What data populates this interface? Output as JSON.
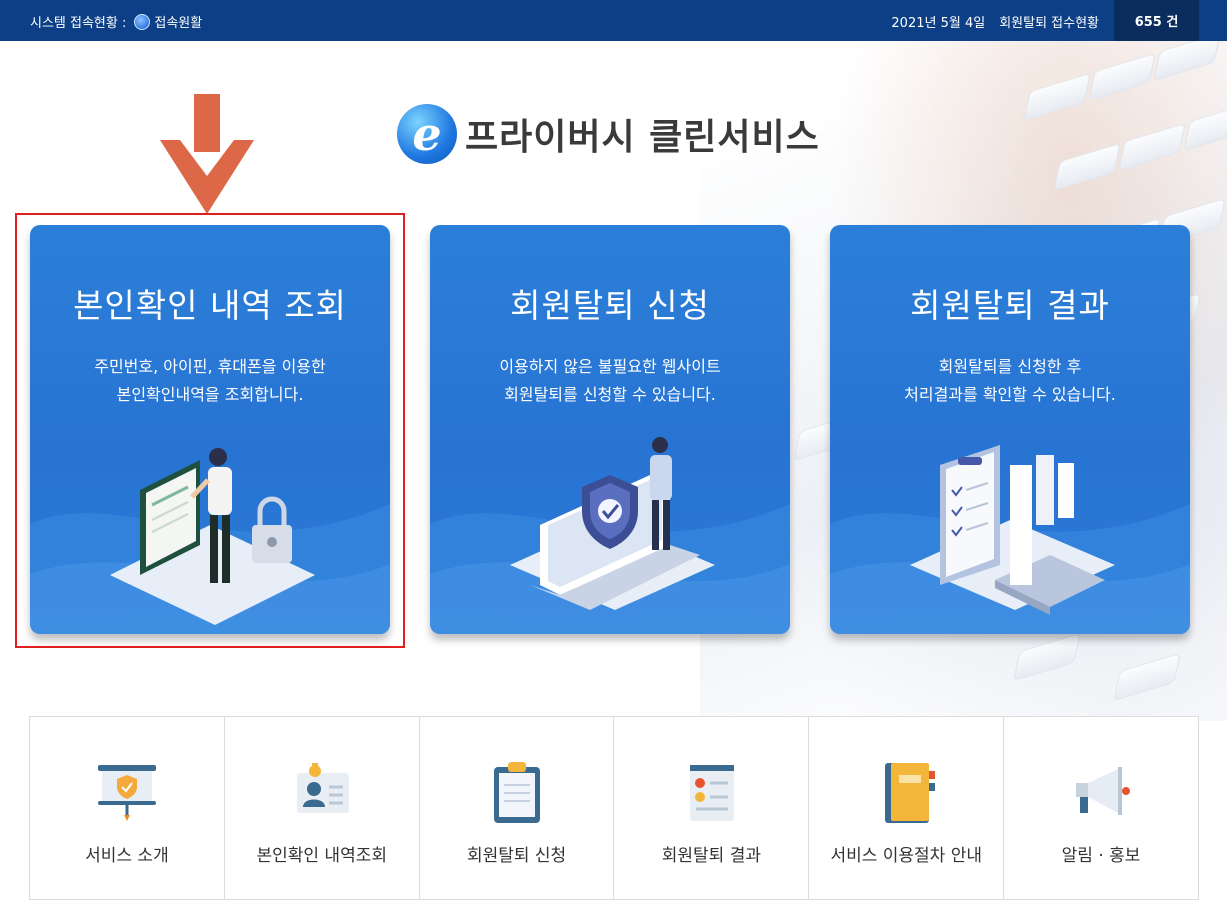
{
  "topbar": {
    "status_label": "시스템 접속현황 :",
    "status_value": "접속원활",
    "date": "2021년 5월 4일",
    "receipt_label": "회원탈퇴 접수현황",
    "count": "655 건"
  },
  "logo": {
    "mark": "e",
    "text": "프라이버시 클린서비스"
  },
  "cards": [
    {
      "title": "본인확인 내역 조회",
      "desc_line1": "주민번호, 아이핀, 휴대폰을 이용한",
      "desc_line2": "본인확인내역을 조회합니다."
    },
    {
      "title": "회원탈퇴 신청",
      "desc_line1": "이용하지 않은 불필요한 웹사이트",
      "desc_line2": "회원탈퇴를 신청할 수 있습니다."
    },
    {
      "title": "회원탈퇴 결과",
      "desc_line1": "회원탈퇴를 신청한 후",
      "desc_line2": "처리결과를 확인할 수 있습니다."
    }
  ],
  "menu": [
    {
      "label": "서비스 소개",
      "icon": "presentation-shield-icon"
    },
    {
      "label": "본인확인 내역조회",
      "icon": "id-card-icon"
    },
    {
      "label": "회원탈퇴 신청",
      "icon": "clipboard-icon"
    },
    {
      "label": "회원탈퇴 결과",
      "icon": "checklist-icon"
    },
    {
      "label": "서비스 이용절차 안내",
      "icon": "notebook-icon"
    },
    {
      "label": "알림 · 홍보",
      "icon": "megaphone-icon"
    }
  ],
  "colors": {
    "topbar": "#0c3f86",
    "card_blue": "#2874d3",
    "highlight_frame": "#e0201f",
    "arrow": "#dd6847"
  }
}
